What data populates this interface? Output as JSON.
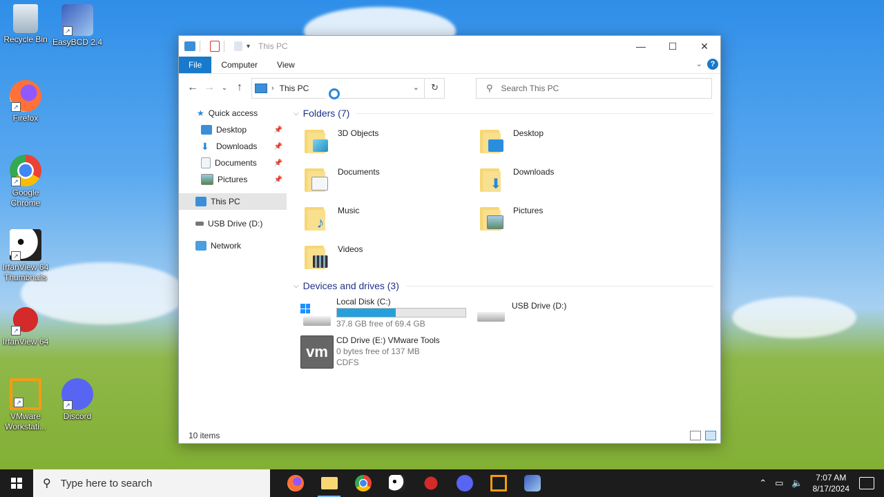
{
  "desktop": {
    "icons": [
      {
        "label": "Recycle Bin",
        "icon": "recycle-bin-icon"
      },
      {
        "label": "EasyBCD 2.4",
        "icon": "easybcd-icon"
      },
      {
        "label": "Firefox",
        "icon": "firefox-icon"
      },
      {
        "label": "Google Chrome",
        "icon": "chrome-icon"
      },
      {
        "label": "IrfanView 64 Thumbnails",
        "icon": "irfanview-thumbnails-icon"
      },
      {
        "label": "IrfanView 64",
        "icon": "irfanview-icon"
      },
      {
        "label": "VMware Workstati...",
        "icon": "vmware-icon"
      },
      {
        "label": "Discord",
        "icon": "discord-icon"
      }
    ]
  },
  "window": {
    "title": "This PC",
    "ribbon_tabs": [
      "File",
      "Computer",
      "View"
    ],
    "address": {
      "location": "This PC"
    },
    "search": {
      "placeholder": "Search This PC"
    },
    "sidebar": {
      "quick_access": "Quick access",
      "quick_items": [
        "Desktop",
        "Downloads",
        "Documents",
        "Pictures"
      ],
      "this_pc": "This PC",
      "usb": "USB Drive (D:)",
      "network": "Network"
    },
    "folders_header": "Folders (7)",
    "folders": [
      "3D Objects",
      "Desktop",
      "Documents",
      "Downloads",
      "Music",
      "Pictures",
      "Videos"
    ],
    "drives_header": "Devices and drives (3)",
    "drives": {
      "c_name": "Local Disk (C:)",
      "c_free": "37.8 GB free of 69.4 GB",
      "c_used_fraction": 0.455,
      "d_name": "USB Drive (D:)",
      "e_name": "CD Drive (E:) VMware Tools",
      "e_free": "0 bytes free of 137 MB",
      "e_fs": "CDFS",
      "e_logo": "vm"
    },
    "status": "10 items"
  },
  "taskbar": {
    "search_placeholder": "Type here to search",
    "apps": [
      "firefox-icon",
      "file-explorer-icon",
      "chrome-icon",
      "irfanview-thumbnails-icon",
      "irfanview-icon",
      "discord-icon",
      "vmware-icon",
      "easybcd-icon"
    ],
    "time": "7:07 AM",
    "date": "8/17/2024"
  },
  "colors": {
    "accent": "#1979ca",
    "progress": "#26a0da",
    "folder": "#f7d774"
  }
}
